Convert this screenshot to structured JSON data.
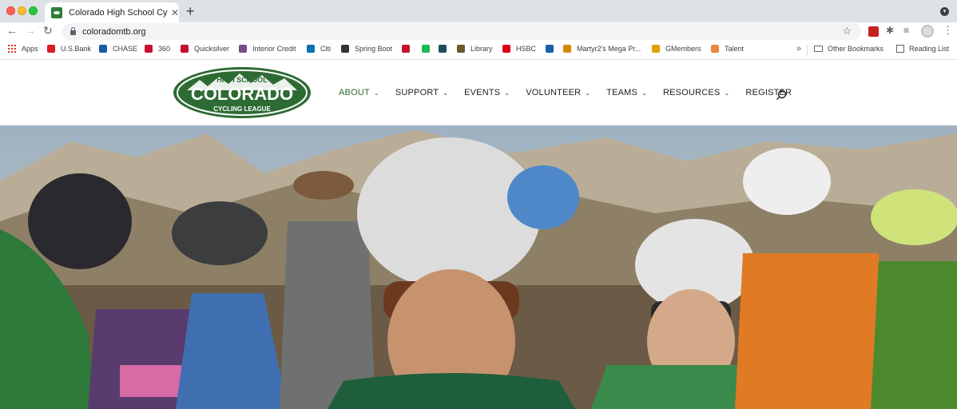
{
  "browser": {
    "tab_title": "Colorado High School Cycling L",
    "url": "coloradomtb.org",
    "bookmarks": [
      {
        "label": "Apps",
        "color": "#d93025"
      },
      {
        "label": "U.S.Bank",
        "color": "#d71e28"
      },
      {
        "label": "CHASE",
        "color": "#1a5aa8"
      },
      {
        "label": "360",
        "color": "#c8102e"
      },
      {
        "label": "Quicksilver",
        "color": "#c8102e"
      },
      {
        "label": "Interior Credit",
        "color": "#7a4b8c"
      },
      {
        "label": "Citi",
        "color": "#0a6fb7"
      },
      {
        "label": "Spring Boot",
        "color": "#333333"
      },
      {
        "label": "",
        "color": "#c8102e"
      },
      {
        "label": "",
        "color": "#1db954"
      },
      {
        "label": "",
        "color": "#1e4e5e"
      },
      {
        "label": "Library",
        "color": "#6b5a2e"
      },
      {
        "label": "HSBC",
        "color": "#db0011"
      },
      {
        "label": "",
        "color": "#1c5fa8"
      },
      {
        "label": "Martyr2's Mega Pr...",
        "color": "#d48a00"
      },
      {
        "label": "GMembers",
        "color": "#e0a000"
      },
      {
        "label": "Talent",
        "color": "#e8863a"
      }
    ],
    "bookmarks_more": "»",
    "other_bookmarks": "Other Bookmarks",
    "reading_list": "Reading List"
  },
  "site": {
    "logo": {
      "top": "HIGH SCHOOL",
      "main": "COLORADO",
      "bottom": "CYCLING LEAGUE",
      "color": "#2e6b34"
    },
    "menu": [
      {
        "label": "ABOUT",
        "active": true
      },
      {
        "label": "SUPPORT"
      },
      {
        "label": "EVENTS"
      },
      {
        "label": "VOLUNTEER"
      },
      {
        "label": "TEAMS"
      },
      {
        "label": "RESOURCES"
      },
      {
        "label": "REGISTER"
      }
    ],
    "hero_alt": "riders in helmets at a race start"
  }
}
